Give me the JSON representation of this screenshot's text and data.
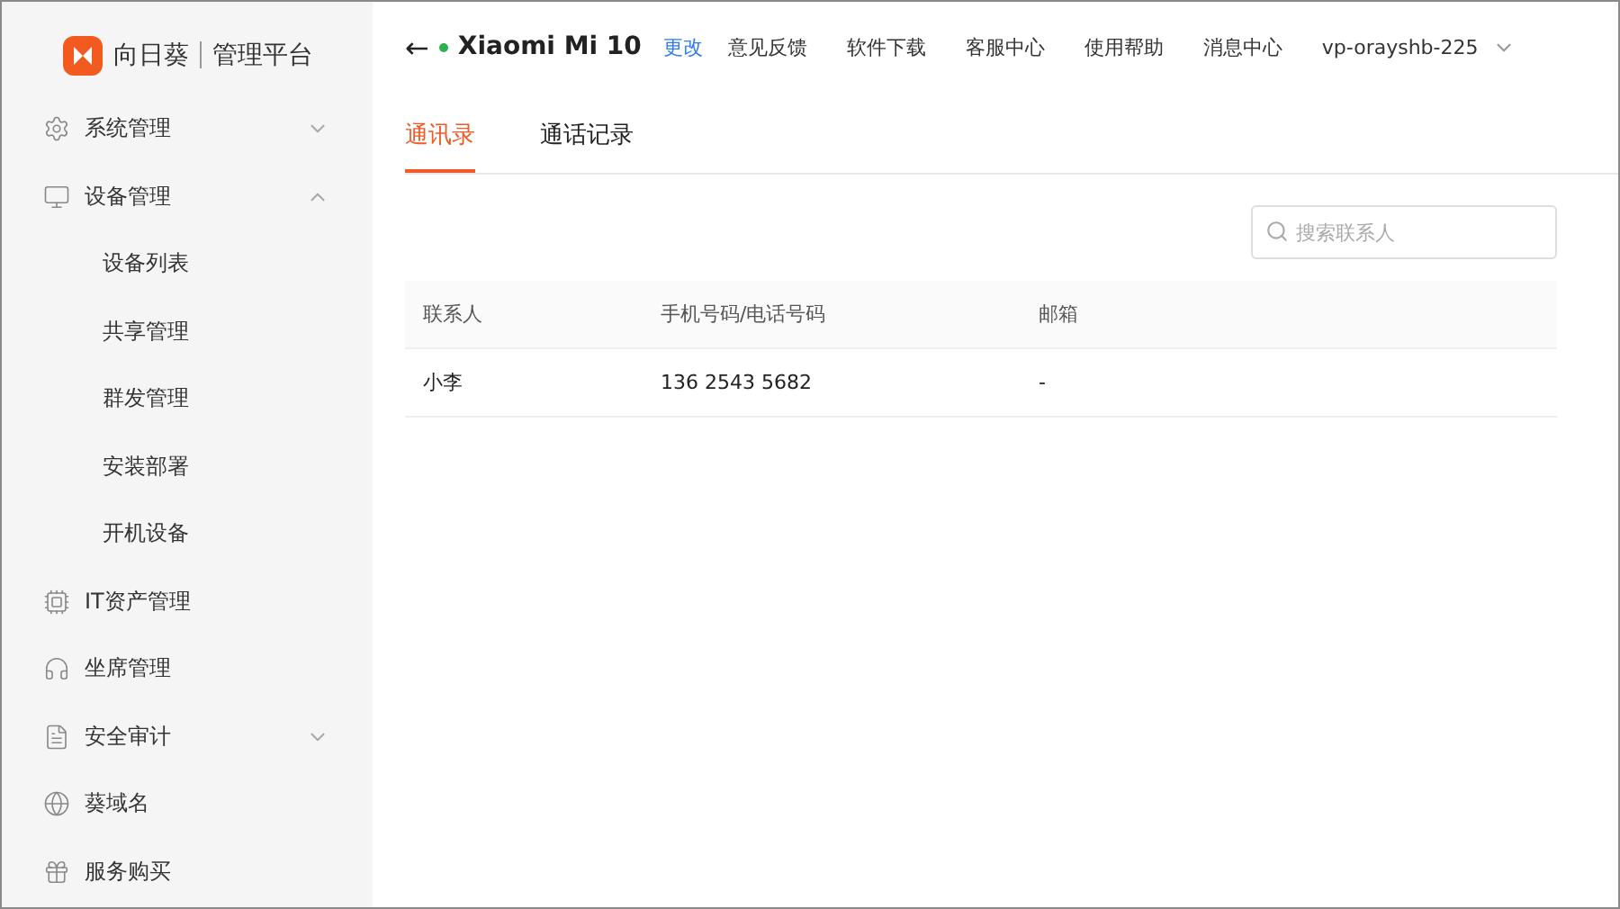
{
  "logo": {
    "brand": "向日葵",
    "product": "管理平台"
  },
  "sidebar": {
    "items": [
      {
        "label": "系统管理",
        "expanded": false
      },
      {
        "label": "设备管理",
        "expanded": true,
        "children": [
          {
            "label": "设备列表"
          },
          {
            "label": "共享管理"
          },
          {
            "label": "群发管理"
          },
          {
            "label": "安装部署"
          },
          {
            "label": "开机设备"
          }
        ]
      },
      {
        "label": "IT资产管理"
      },
      {
        "label": "坐席管理"
      },
      {
        "label": "安全审计",
        "expanded": false
      },
      {
        "label": "葵域名"
      },
      {
        "label": "服务购买"
      }
    ]
  },
  "header": {
    "back": "←",
    "device": "Xiaomi Mi 10",
    "online": true,
    "rename": "更改",
    "links": [
      "意见反馈",
      "软件下载",
      "客服中心",
      "使用帮助",
      "消息中心"
    ],
    "account": "vp-orayshb-225"
  },
  "tabs": [
    {
      "label": "通讯录",
      "selected": true
    },
    {
      "label": "通话记录",
      "selected": false
    }
  ],
  "search": {
    "placeholder": "搜索联系人"
  },
  "table": {
    "columns": [
      "联系人",
      "手机号码/电话号码",
      "邮箱"
    ],
    "rows": [
      [
        "小李",
        "136 2543 5682",
        "-"
      ]
    ]
  }
}
